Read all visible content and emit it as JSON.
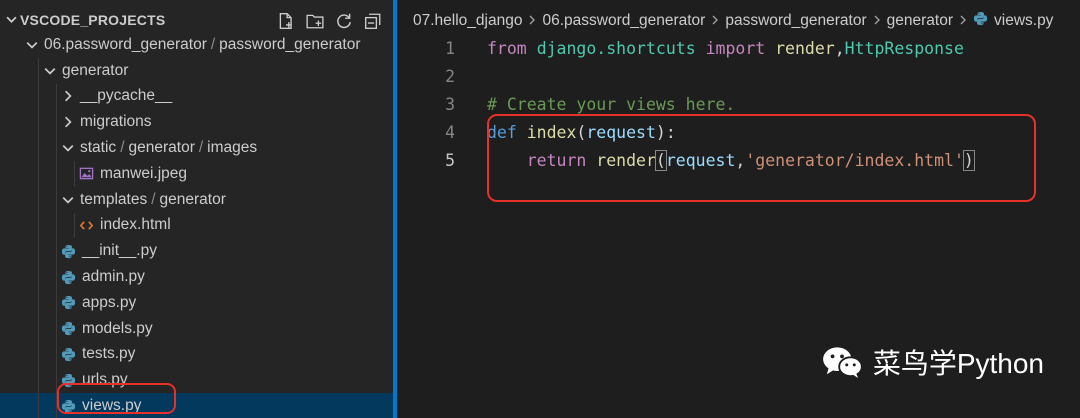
{
  "sidebar": {
    "title": "VSCODE_PROJECTS",
    "actions": [
      {
        "name": "new-file-icon"
      },
      {
        "name": "new-folder-icon"
      },
      {
        "name": "refresh-icon"
      },
      {
        "name": "collapse-all-icon"
      }
    ],
    "tree": [
      {
        "name": "folder-06-password-generator",
        "label": "06.password_generator",
        "label2": "password_generator",
        "indent": 1,
        "twisty": "open",
        "icon": ""
      },
      {
        "name": "folder-generator",
        "label": "generator",
        "indent": 2,
        "twisty": "open",
        "icon": ""
      },
      {
        "name": "folder-pycache",
        "label": "__pycache__",
        "indent": 3,
        "twisty": "closed",
        "icon": ""
      },
      {
        "name": "folder-migrations",
        "label": "migrations",
        "indent": 3,
        "twisty": "closed",
        "icon": ""
      },
      {
        "name": "folder-static",
        "label": "static",
        "label2": "generator",
        "label3": "images",
        "indent": 3,
        "twisty": "open",
        "icon": ""
      },
      {
        "name": "file-manwei-jpeg",
        "label": "manwei.jpeg",
        "indent": 4,
        "twisty": "none",
        "icon": "image"
      },
      {
        "name": "folder-templates",
        "label": "templates",
        "label2": "generator",
        "indent": 3,
        "twisty": "open",
        "icon": ""
      },
      {
        "name": "file-index-html",
        "label": "index.html",
        "indent": 4,
        "twisty": "none",
        "icon": "html"
      },
      {
        "name": "file-init-py",
        "label": "__init__.py",
        "indent": 3,
        "twisty": "none",
        "icon": "python"
      },
      {
        "name": "file-admin-py",
        "label": "admin.py",
        "indent": 3,
        "twisty": "none",
        "icon": "python"
      },
      {
        "name": "file-apps-py",
        "label": "apps.py",
        "indent": 3,
        "twisty": "none",
        "icon": "python"
      },
      {
        "name": "file-models-py",
        "label": "models.py",
        "indent": 3,
        "twisty": "none",
        "icon": "python"
      },
      {
        "name": "file-tests-py",
        "label": "tests.py",
        "indent": 3,
        "twisty": "none",
        "icon": "python"
      },
      {
        "name": "file-urls-py",
        "label": "urls.py",
        "indent": 3,
        "twisty": "none",
        "icon": "python"
      },
      {
        "name": "file-views-py",
        "label": "views.py",
        "indent": 3,
        "twisty": "none",
        "icon": "python",
        "selected": true
      }
    ]
  },
  "breadcrumbs": {
    "items": [
      "07.hello_django",
      "06.password_generator",
      "password_generator",
      "generator"
    ],
    "file": "views.py"
  },
  "editor": {
    "lines": [
      {
        "n": "1",
        "tokens": [
          {
            "c": "kw-import",
            "t": "from"
          },
          {
            "c": "",
            "t": " "
          },
          {
            "c": "mod",
            "t": "django.shortcuts"
          },
          {
            "c": "",
            "t": " "
          },
          {
            "c": "kw-import",
            "t": "import"
          },
          {
            "c": "",
            "t": " "
          },
          {
            "c": "fn",
            "t": "render"
          },
          {
            "c": "",
            "t": ","
          },
          {
            "c": "cls",
            "t": "HttpResponse"
          }
        ]
      },
      {
        "n": "2",
        "tokens": []
      },
      {
        "n": "3",
        "tokens": [
          {
            "c": "cmt",
            "t": "# Create your views here."
          }
        ]
      },
      {
        "n": "4",
        "tokens": [
          {
            "c": "kw-def",
            "t": "def"
          },
          {
            "c": "",
            "t": " "
          },
          {
            "c": "fn",
            "t": "index"
          },
          {
            "c": "",
            "t": "("
          },
          {
            "c": "param",
            "t": "request"
          },
          {
            "c": "",
            "t": "):"
          }
        ]
      },
      {
        "n": "5",
        "active": true,
        "tokens": [
          {
            "c": "",
            "t": "    "
          },
          {
            "c": "kw-import",
            "t": "return"
          },
          {
            "c": "",
            "t": " "
          },
          {
            "c": "fn",
            "t": "render"
          },
          {
            "c": "brk",
            "t": "("
          },
          {
            "c": "param",
            "t": "request"
          },
          {
            "c": "",
            "t": ","
          },
          {
            "c": "str",
            "t": "'generator/index.html'"
          },
          {
            "c": "brk",
            "t": ")"
          }
        ]
      }
    ]
  },
  "watermark": {
    "text": "菜鸟学Python"
  },
  "colors": {
    "accent": "#007acc",
    "highlight": "#e8302a",
    "selection": "#04395e"
  }
}
